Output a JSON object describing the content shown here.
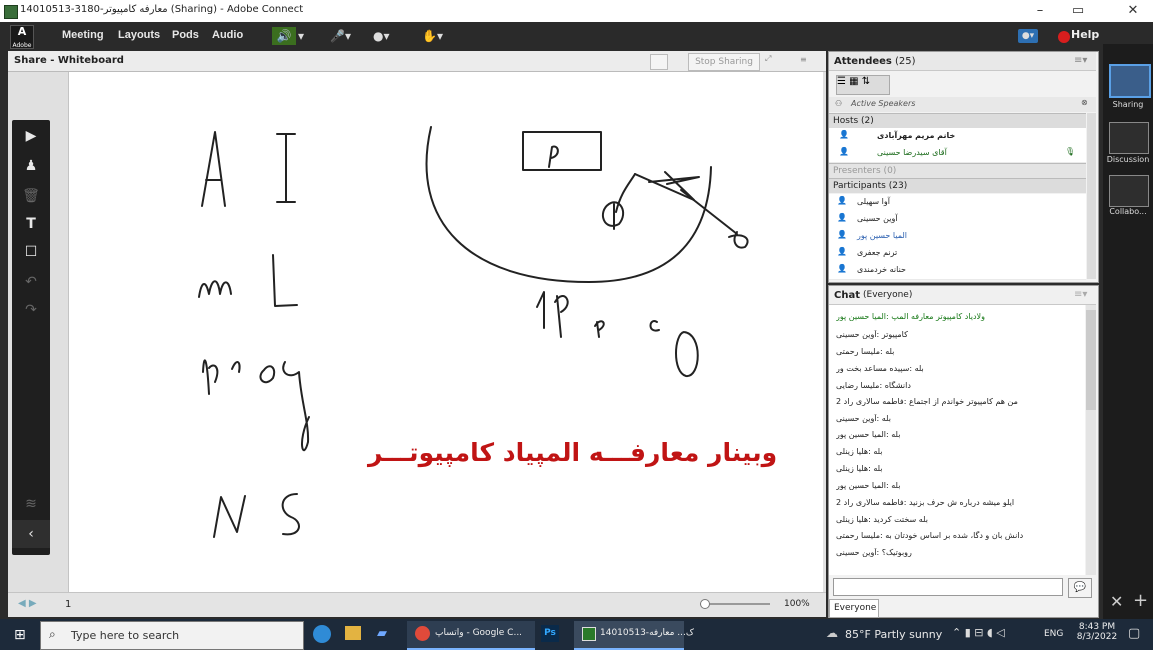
{
  "window": {
    "title": "14010513-3180-معارفه کامپیوتر (Sharing) - Adobe Connect",
    "minimize": "–",
    "maximize": "▭",
    "close": "✕"
  },
  "menubar": {
    "logo": "Adobe",
    "items": [
      "Meeting",
      "Layouts",
      "Pods",
      "Audio"
    ],
    "help": "Help"
  },
  "share_pod": {
    "title": "Share - Whiteboard",
    "stop_sharing": "Stop Sharing",
    "page_number": "1",
    "zoom": "100%"
  },
  "whiteboard": {
    "banner": "وبینار معارفـــه المپیاد کامپیوتـــر",
    "handwriting": [
      "A",
      "I",
      "m",
      "L",
      "prog",
      "N",
      "S",
      "P",
      "1P",
      "P",
      "C",
      "O"
    ]
  },
  "attendees": {
    "title": "Attendees",
    "count": "(25)",
    "active_speakers": "Active Speakers",
    "hosts_label": "Hosts (2)",
    "hosts": [
      "خانم مریم مهرآبادی",
      "آقای سیدرضا حسینی"
    ],
    "presenters_label": "Presenters (0)",
    "participants_label": "Participants (23)",
    "participants": [
      "آوا سهیلی",
      "آوین حسینی",
      "المیا حسین پور",
      "ترنم جعفری",
      "حنانه خردمندی"
    ]
  },
  "chat": {
    "title": "Chat",
    "scope": "(Everyone)",
    "messages": [
      "ولادیاد کامپیوتر معارفه المپ :المیا حسین پور",
      "کامپیوتر :آوین حسینی",
      "بله :ملیسا رحمتی",
      "بله :سپیده مساعد بخت ور",
      "دانشگاه :ملیسا رضایی",
      "من هم کامپیوتر خواندم از اجتماع :فاطمه سالاری راد 2",
      "بله :آوین حسینی",
      "بله :المیا حسین پور",
      "بله :هلیا زینلی",
      "بله :هلیا زینلی",
      "بله :المیا حسین پور",
      "ایلو میشه درباره ش حرف بزنید :فاطمه سالاری راد 2",
      "بله سختت کردید :هلیا زینلی",
      "دانش بان و دگا، شده بر اساس خودتان به :ملیسا رحمتی",
      "روبوتیک؟ :آوین حسینی"
    ],
    "input_placeholder": "",
    "audience": "Everyone"
  },
  "layouts": [
    {
      "label": "Sharing"
    },
    {
      "label": "Discussion"
    },
    {
      "label": "Collabo..."
    }
  ],
  "taskbar": {
    "search_placeholder": "Type here to search",
    "apps": [
      "واتساپ - Google C...",
      "Ps",
      "14010513-ک... معارفه"
    ],
    "weather": "85°F Partly sunny",
    "language": "ENG",
    "time": "8:43 PM",
    "date": "8/3/2022"
  },
  "colors": {
    "banner": "#c01414",
    "chrome_dark": "#2a2a2a",
    "host_highlight": "#1a6a1a"
  }
}
